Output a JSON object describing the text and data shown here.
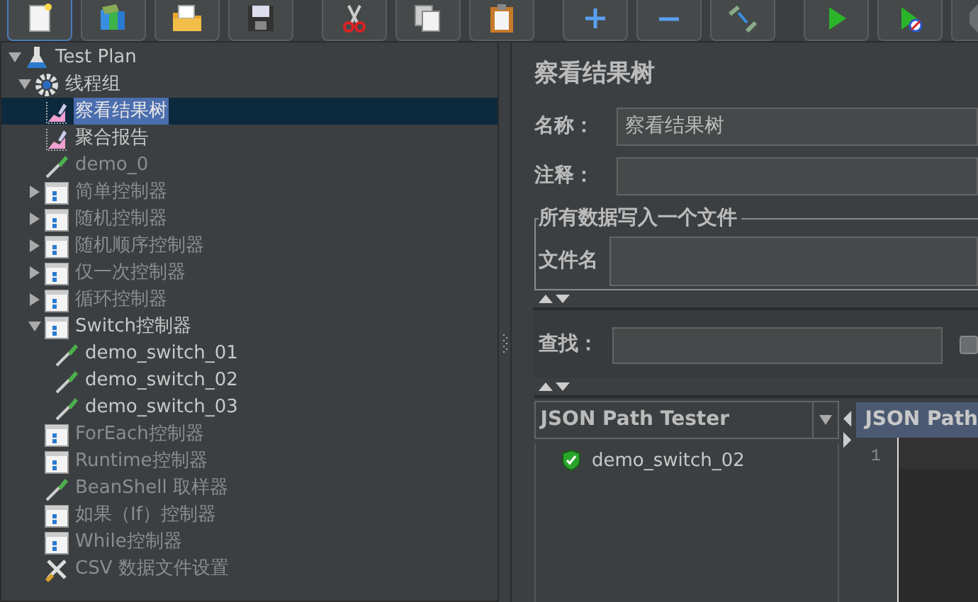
{
  "toolbar": [
    {
      "kind": "new",
      "focused": true
    },
    {
      "kind": "templates",
      "focused": false
    },
    {
      "kind": "open",
      "focused": false
    },
    {
      "kind": "save",
      "focused": false
    },
    {
      "kind": "cut",
      "focused": false
    },
    {
      "kind": "copy",
      "focused": false
    },
    {
      "kind": "paste",
      "focused": false
    },
    {
      "kind": "expand",
      "focused": false
    },
    {
      "kind": "collapse",
      "focused": false
    },
    {
      "kind": "toggle",
      "focused": false
    },
    {
      "kind": "start",
      "focused": false
    },
    {
      "kind": "start_no_pause",
      "focused": false
    },
    {
      "kind": "stop",
      "focused": false
    }
  ],
  "tree": [
    {
      "label": "Test Plan",
      "kind": "plan",
      "expanded": true,
      "disabled": false,
      "selected": false,
      "children": [
        {
          "label": "线程组",
          "kind": "thread_group",
          "expanded": true,
          "disabled": false,
          "selected": false,
          "children": [
            {
              "label": "察看结果树",
              "kind": "listener",
              "disabled": false,
              "selected": true
            },
            {
              "label": "聚合报告",
              "kind": "listener",
              "disabled": false,
              "selected": false
            },
            {
              "label": "demo_0",
              "kind": "sampler",
              "disabled": true,
              "selected": false
            },
            {
              "label": "简单控制器",
              "kind": "controller",
              "expanded": false,
              "disabled": true,
              "selected": false
            },
            {
              "label": "随机控制器",
              "kind": "controller",
              "expanded": false,
              "disabled": true,
              "selected": false
            },
            {
              "label": "随机顺序控制器",
              "kind": "controller",
              "expanded": false,
              "disabled": true,
              "selected": false
            },
            {
              "label": "仅一次控制器",
              "kind": "controller",
              "expanded": false,
              "disabled": true,
              "selected": false
            },
            {
              "label": "循环控制器",
              "kind": "controller",
              "expanded": false,
              "disabled": true,
              "selected": false
            },
            {
              "label": "Switch控制器",
              "kind": "controller",
              "expanded": true,
              "disabled": false,
              "selected": false,
              "children": [
                {
                  "label": "demo_switch_01",
                  "kind": "sampler",
                  "disabled": false,
                  "selected": false
                },
                {
                  "label": "demo_switch_02",
                  "kind": "sampler",
                  "disabled": false,
                  "selected": false
                },
                {
                  "label": "demo_switch_03",
                  "kind": "sampler",
                  "disabled": false,
                  "selected": false
                }
              ]
            },
            {
              "label": "ForEach控制器",
              "kind": "controller",
              "disabled": true,
              "selected": false
            },
            {
              "label": "Runtime控制器",
              "kind": "controller",
              "disabled": true,
              "selected": false
            },
            {
              "label": "BeanShell 取样器",
              "kind": "sampler",
              "disabled": true,
              "selected": false
            },
            {
              "label": "如果（If）控制器",
              "kind": "controller",
              "disabled": true,
              "selected": false
            },
            {
              "label": "While控制器",
              "kind": "controller",
              "disabled": true,
              "selected": false
            },
            {
              "label": "CSV 数据文件设置",
              "kind": "config",
              "disabled": true,
              "selected": false
            }
          ]
        }
      ]
    }
  ],
  "panel": {
    "title": "察看结果树",
    "name_label": "名称：",
    "name_value": "察看结果树",
    "comment_label": "注释：",
    "file_group": {
      "legend": "所有数据写入一个文件",
      "filename_label": "文件名"
    },
    "search_label": "查找：",
    "search_checkbox": {
      "checked": false
    },
    "renderer": {
      "value": "JSON Path Tester"
    },
    "results": [
      {
        "label": "demo_switch_02",
        "passed": true
      }
    ],
    "tester_tab": "JSON Path",
    "line_numbers": [
      "1"
    ]
  }
}
